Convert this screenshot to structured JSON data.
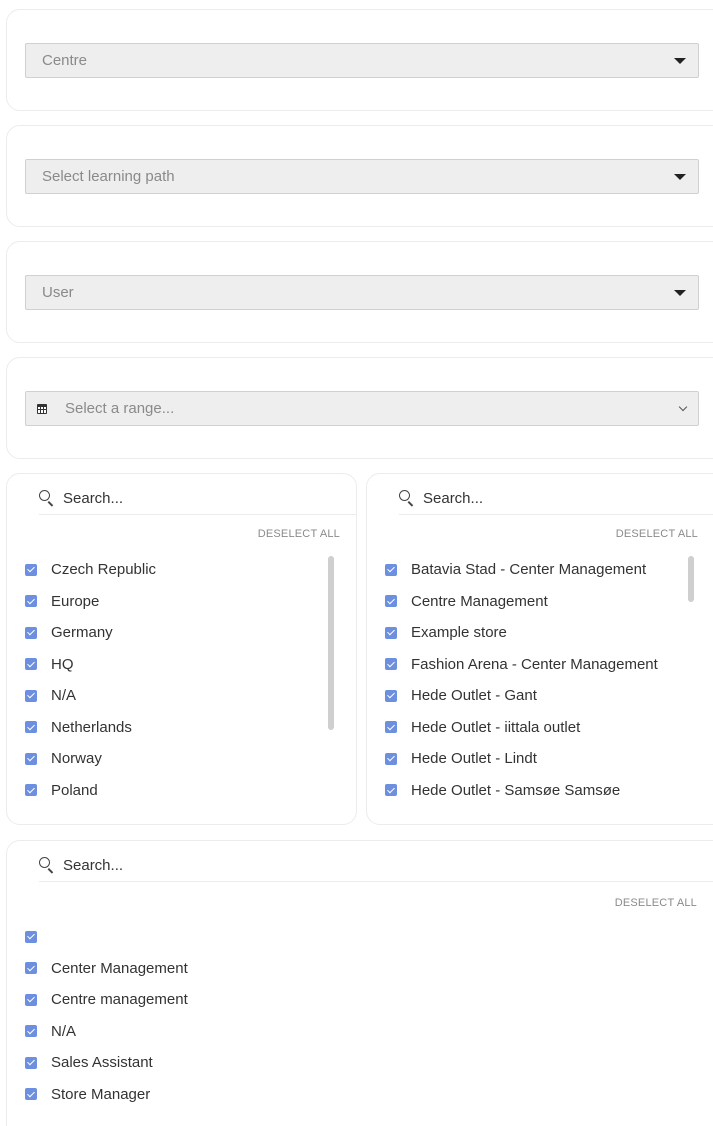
{
  "filters": {
    "centre": {
      "placeholder": "Centre"
    },
    "learning_path": {
      "placeholder": "Select learning path"
    },
    "user": {
      "placeholder": "User"
    },
    "date_range": {
      "placeholder": "Select a range..."
    }
  },
  "countries_panel": {
    "search_placeholder": "Search...",
    "deselect_label": "DESELECT ALL",
    "items": [
      {
        "label": "Czech Republic",
        "checked": true
      },
      {
        "label": "Europe",
        "checked": true
      },
      {
        "label": "Germany",
        "checked": true
      },
      {
        "label": "HQ",
        "checked": true
      },
      {
        "label": "N/A",
        "checked": true
      },
      {
        "label": "Netherlands",
        "checked": true
      },
      {
        "label": "Norway",
        "checked": true
      },
      {
        "label": "Poland",
        "checked": true
      }
    ]
  },
  "stores_panel": {
    "search_placeholder": "Search...",
    "deselect_label": "DESELECT ALL",
    "items": [
      {
        "label": "Batavia Stad - Center Management",
        "checked": true
      },
      {
        "label": "Centre Management",
        "checked": true
      },
      {
        "label": "Example store",
        "checked": true
      },
      {
        "label": "Fashion Arena - Center Management",
        "checked": true
      },
      {
        "label": "Hede Outlet - Gant",
        "checked": true
      },
      {
        "label": "Hede Outlet - iittala outlet",
        "checked": true
      },
      {
        "label": "Hede Outlet - Lindt",
        "checked": true
      },
      {
        "label": "Hede Outlet - Samsøe Samsøe",
        "checked": true
      }
    ]
  },
  "roles_panel": {
    "search_placeholder": "Search...",
    "deselect_label": "DESELECT ALL",
    "items": [
      {
        "label": "",
        "checked": true
      },
      {
        "label": "Center Management",
        "checked": true
      },
      {
        "label": "Centre management",
        "checked": true
      },
      {
        "label": "N/A",
        "checked": true
      },
      {
        "label": "Sales Assistant",
        "checked": true
      },
      {
        "label": "Store Manager",
        "checked": true
      }
    ]
  },
  "colors": {
    "checkbox": "#6d8fe0",
    "select_bg": "#eeeeee",
    "border": "#ececec"
  }
}
